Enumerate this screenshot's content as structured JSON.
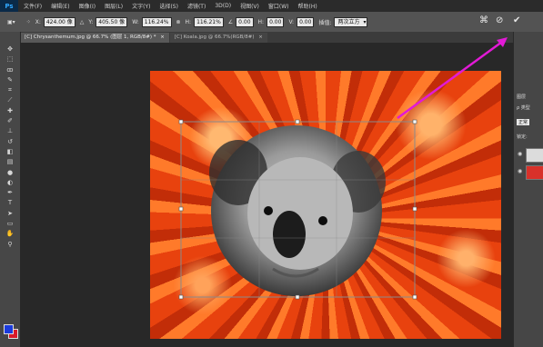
{
  "app": {
    "logo": "Ps"
  },
  "menu": [
    "文件(F)",
    "编辑(E)",
    "图像(I)",
    "图层(L)",
    "文字(Y)",
    "选择(S)",
    "滤镜(T)",
    "3D(D)",
    "视图(V)",
    "窗口(W)",
    "帮助(H)"
  ],
  "options": {
    "x_label": "X:",
    "x_value": "424.00 像",
    "y_label": "Y:",
    "y_value": "405.50 像",
    "w_label": "W:",
    "w_value": "116.24%",
    "h_label": "H:",
    "h_value": "116.21%",
    "angle_value": "0.00",
    "hskew_label": "H:",
    "hskew_value": "0.00",
    "vskew_label": "V:",
    "vskew_value": "0.00",
    "interp_label": "插值:",
    "interp_value": "两次立方"
  },
  "tabs": [
    {
      "label": "[C] Chrysanthemum.jpg @ 66.7% (图层 1, RGB/8#) *",
      "close": "×"
    },
    {
      "label": "[C] Koala.jpg @ 66.7%(RGB/8#)",
      "close": "×"
    }
  ],
  "layers_panel": {
    "title": "图层",
    "kind_label": "ρ 类型",
    "blend_mode": "正常",
    "lock_label": "锁定:"
  },
  "colors": {
    "accent_arrow": "#e21ad6",
    "foreground": "#1b3bdc",
    "background": "#d8192a"
  },
  "icons": [
    "move-icon",
    "marquee-icon",
    "lasso-icon",
    "quick-select-icon",
    "crop-icon",
    "eyedropper-icon",
    "healing-icon",
    "brush-icon",
    "stamp-icon",
    "history-brush-icon",
    "eraser-icon",
    "gradient-icon",
    "blur-icon",
    "dodge-icon",
    "pen-icon",
    "type-icon",
    "path-select-icon",
    "shape-icon",
    "hand-icon",
    "zoom-icon"
  ]
}
